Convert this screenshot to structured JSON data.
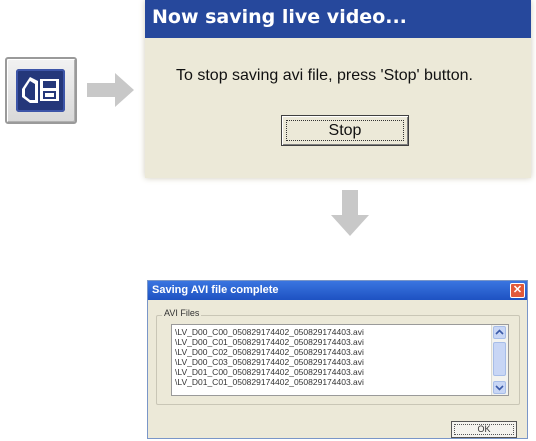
{
  "save_dialog": {
    "title": "Now saving live video...",
    "message": "To stop saving avi file, press 'Stop' button.",
    "stop_label": "Stop"
  },
  "complete_dialog": {
    "title": "Saving AVI file complete",
    "close_glyph": "✕",
    "group_label": "AVI Files",
    "files": [
      "\\LV_D00_C00_050829174402_050829174403.avi",
      "\\LV_D00_C01_050829174402_050829174403.avi",
      "\\LV_D00_C02_050829174402_050829174403.avi",
      "\\LV_D00_C03_050829174402_050829174403.avi",
      "\\LV_D01_C00_050829174402_050829174403.avi",
      "\\LV_D01_C01_050829174402_050829174403.avi"
    ],
    "ok_label": "OK"
  },
  "icons": {
    "save_button": "save-video-icon",
    "arrow_right": "arrow-right-icon",
    "arrow_down": "arrow-down-icon"
  },
  "colors": {
    "title_bar_blue": "#26489c",
    "dialog_bg": "#ece9d8",
    "xp_title": "#1e52c2",
    "close_red": "#e25a3a",
    "arrow_gray": "#c8c8c8"
  }
}
